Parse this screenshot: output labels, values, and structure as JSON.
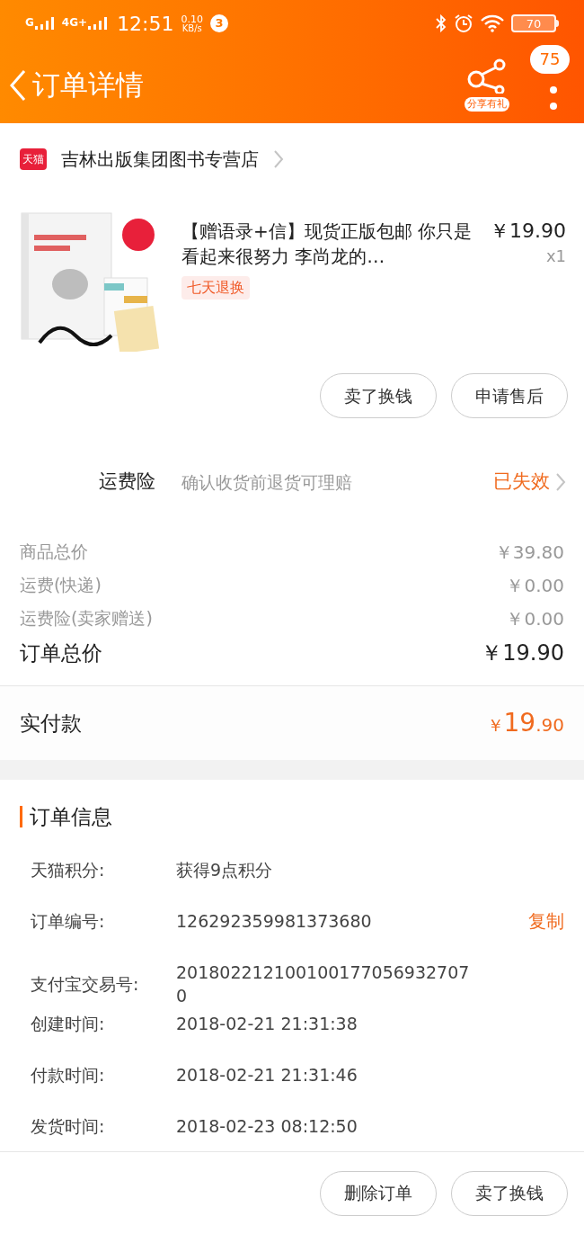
{
  "status_bar": {
    "network_1": "G",
    "network_2": "4G+",
    "time": "12:51",
    "speed_value": "0.10",
    "speed_unit": "KB/s",
    "notifications": "3",
    "battery": "70"
  },
  "nav": {
    "title": "订单详情",
    "share_label": "分享有礼",
    "message_count": "75"
  },
  "shop": {
    "badge": "天猫",
    "name": "吉林出版集团图书专营店"
  },
  "product": {
    "image": {
      "kind": "picture"
    },
    "title": "【赠语录+信】现货正版包邮 你只是看起来很努力 李尚龙的…",
    "price": "￥19.90",
    "quantity": "x1",
    "tag": "七天退换",
    "buttons": [
      "卖了换钱",
      "申请售后"
    ]
  },
  "insurance": {
    "label": "运费险",
    "description": "确认收货前退货可理赔",
    "status": "已失效"
  },
  "costs": [
    {
      "label": "商品总价",
      "value": "￥39.80"
    },
    {
      "label": "运费(快递)",
      "value": "￥0.00"
    },
    {
      "label": "运费险(卖家赠送)",
      "value": "￥0.00"
    }
  ],
  "order_total": {
    "label": "订单总价",
    "value": "￥19.90"
  },
  "paid": {
    "label": "实付款",
    "currency": "￥",
    "integer": "19",
    "decimal": ".90"
  },
  "order_info": {
    "title": "订单信息",
    "rows": [
      {
        "label": "天猫积分:",
        "value": "获得9点积分"
      },
      {
        "label": "订单编号:",
        "value": "126292359981373680",
        "action": "复制"
      },
      {
        "label": "支付宝交易号:",
        "value": "2018022121001001770569327070"
      },
      {
        "label": "创建时间:",
        "value": "2018-02-21 21:31:38"
      },
      {
        "label": "付款时间:",
        "value": "2018-02-21 21:31:46"
      },
      {
        "label": "发货时间:",
        "value": "2018-02-23 08:12:50"
      }
    ]
  },
  "bottom_buttons": [
    "删除订单",
    "卖了换钱"
  ]
}
